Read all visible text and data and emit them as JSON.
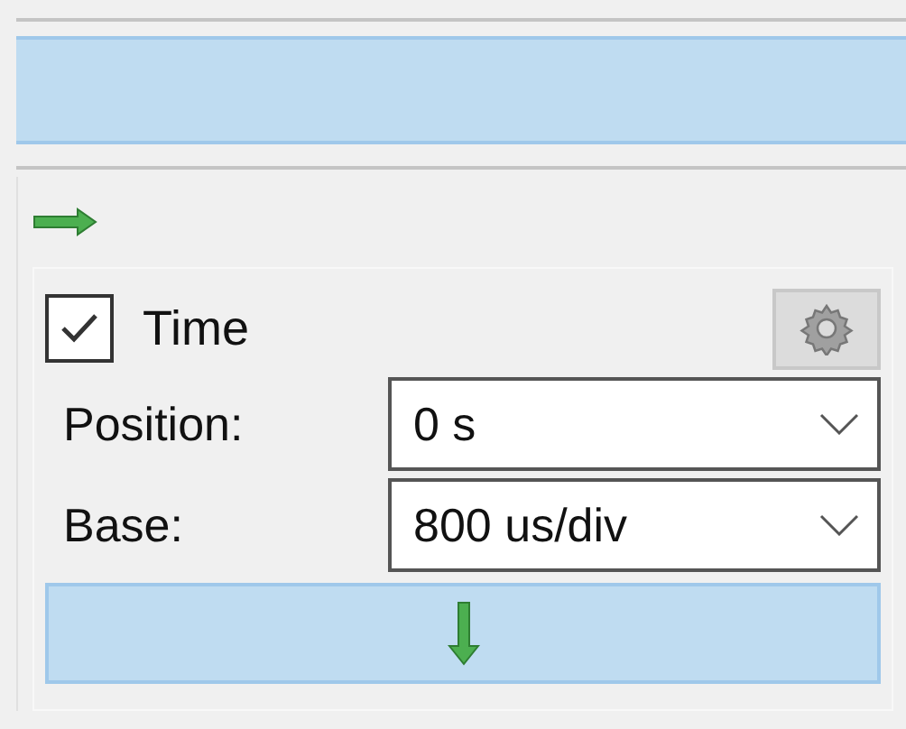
{
  "time_panel": {
    "enabled": true,
    "label": "Time",
    "fields": [
      {
        "label": "Position:",
        "value": "0 s"
      },
      {
        "label": "Base:",
        "value": "800 us/div"
      }
    ]
  }
}
